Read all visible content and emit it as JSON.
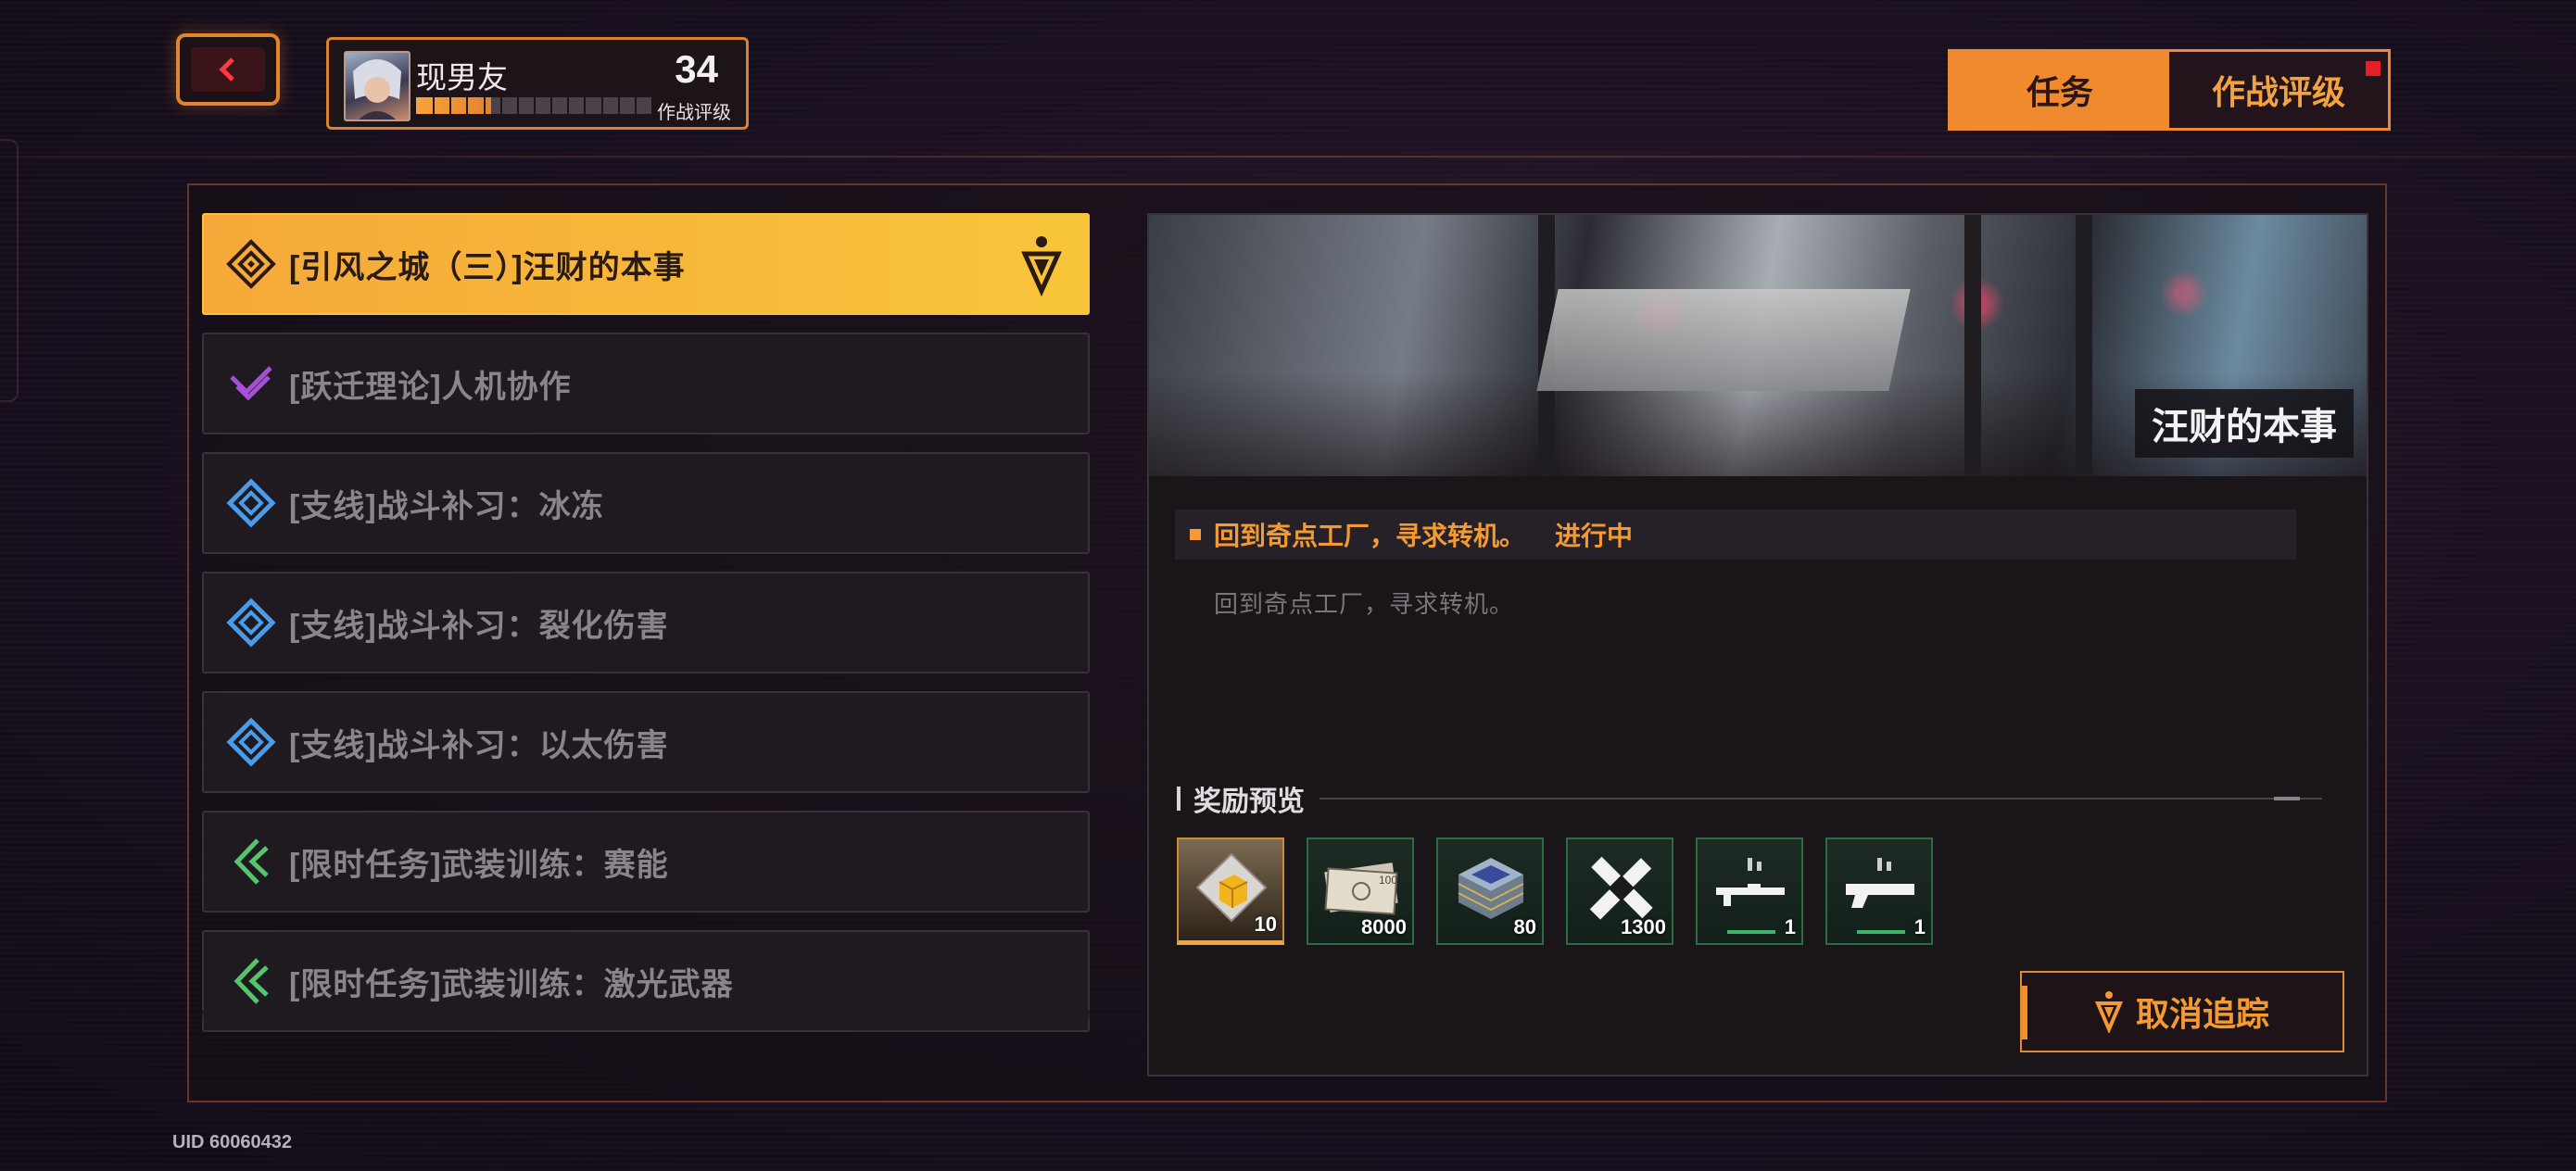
{
  "header": {
    "back_icon": "chevron-left-icon",
    "profile": {
      "name": "现男友",
      "level": "34",
      "level_label": "作战评级",
      "xp_progress": 0.32
    },
    "tabs": [
      {
        "label": "任务",
        "active": true
      },
      {
        "label": "作战评级",
        "active": false,
        "has_notification": true
      }
    ]
  },
  "quests": [
    {
      "label": "[引风之城（三）]汪财的本事",
      "type": "main",
      "icon": "main-quest-icon",
      "color": "#f39a2b",
      "selected": true,
      "tracked": true
    },
    {
      "label": "[跃迁理论]人机协作",
      "type": "theory",
      "icon": "theory-quest-icon",
      "color": "#a64fd8",
      "selected": false
    },
    {
      "label": "[支线]战斗补习：冰冻",
      "type": "side",
      "icon": "side-quest-icon",
      "color": "#4a9be8",
      "selected": false
    },
    {
      "label": "[支线]战斗补习：裂化伤害",
      "type": "side",
      "icon": "side-quest-icon",
      "color": "#4a9be8",
      "selected": false
    },
    {
      "label": "[支线]战斗补习：以太伤害",
      "type": "side",
      "icon": "side-quest-icon",
      "color": "#4a9be8",
      "selected": false
    },
    {
      "label": "[限时任务]武装训练：赛能",
      "type": "limited",
      "icon": "limited-quest-icon",
      "color": "#55c46a",
      "selected": false
    },
    {
      "label": "[限时任务]武装训练：激光武器",
      "type": "limited",
      "icon": "limited-quest-icon",
      "color": "#55c46a",
      "selected": false
    }
  ],
  "detail": {
    "banner_title": "汪财的本事",
    "objective": "回到奇点工厂，寻求转机。",
    "objective_status": "进行中",
    "description": "回到奇点工厂，寻求转机。",
    "rewards_title": "奖励预览",
    "rewards": [
      {
        "icon": "gold-cube-icon",
        "count": "10",
        "rarity": "gold"
      },
      {
        "icon": "banknotes-icon",
        "count": "8000",
        "rarity": "green"
      },
      {
        "icon": "chip-stack-icon",
        "count": "80",
        "rarity": "green"
      },
      {
        "icon": "crossed-tools-icon",
        "count": "1300",
        "rarity": "green"
      },
      {
        "icon": "rifle-icon",
        "count": "1",
        "rarity": "green"
      },
      {
        "icon": "shotgun-icon",
        "count": "1",
        "rarity": "green"
      }
    ],
    "untrack_label": "取消追踪"
  },
  "footer": {
    "uid": "UID 60060432"
  }
}
